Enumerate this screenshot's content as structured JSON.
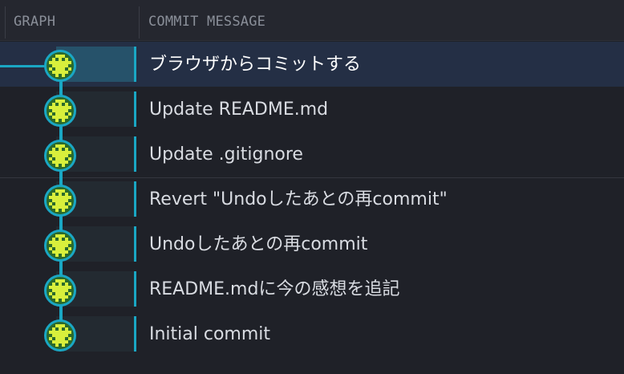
{
  "header": {
    "graph_label": "GRAPH",
    "message_label": "COMMIT MESSAGE"
  },
  "colors": {
    "background": "#1f2128",
    "header": "#25272f",
    "selected_row": "#242f45",
    "branch_line": "#1aa7c4",
    "avatar_bg": "#2b6a2c",
    "avatar_face": "#d8ef3c"
  },
  "avatar_icon": "identicon-avatar",
  "commits": [
    {
      "message": "ブラウザからコミットする",
      "selected": true
    },
    {
      "message": "Update README.md",
      "selected": false
    },
    {
      "message": "Update .gitignore",
      "selected": false
    },
    {
      "message": "Revert \"Undoしたあとの再commit\"",
      "selected": false
    },
    {
      "message": "Undoしたあとの再commit",
      "selected": false
    },
    {
      "message": "README.mdに今の感想を追記",
      "selected": false
    },
    {
      "message": "Initial commit",
      "selected": false
    }
  ]
}
